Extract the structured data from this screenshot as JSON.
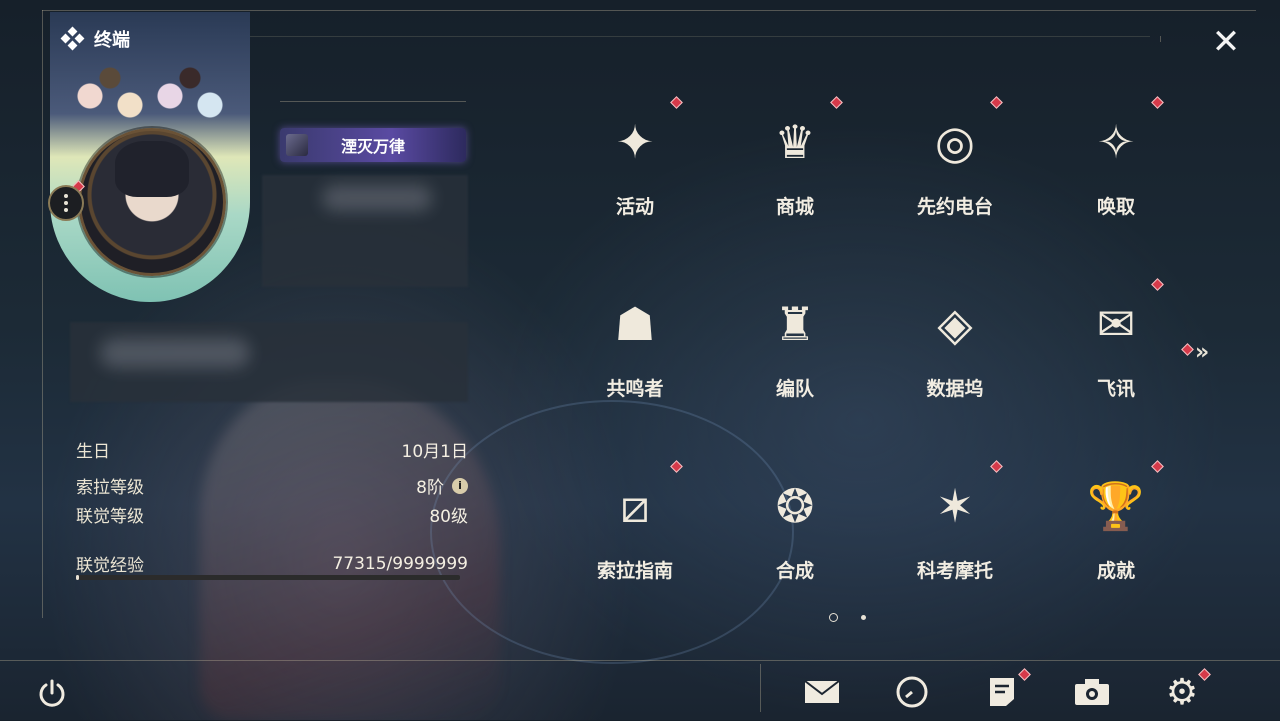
{
  "header": {
    "terminal_label": "终端"
  },
  "profile": {
    "title_badge": "湮灭万律",
    "info": [
      {
        "key": "生日",
        "value": "10月1日"
      },
      {
        "key": "索拉等级",
        "value": "8阶"
      },
      {
        "key": "联觉等级",
        "value": "80级"
      }
    ],
    "exp_label": "联觉经验",
    "exp_value": "77315/9999999",
    "exp_progress": 0.0077
  },
  "menu": [
    {
      "label": "活动",
      "icon": "event-2hd-icon",
      "glyph": "✦",
      "badge": true
    },
    {
      "label": "商城",
      "icon": "shop-cart-icon",
      "glyph": "♛",
      "badge": true
    },
    {
      "label": "先约电台",
      "icon": "radio-icon",
      "glyph": "◎",
      "badge": true
    },
    {
      "label": "唤取",
      "icon": "summon-compass-icon",
      "glyph": "✧",
      "badge": true
    },
    {
      "label": "共鸣者",
      "icon": "resonator-head-icon",
      "glyph": "☗",
      "badge": false
    },
    {
      "label": "编队",
      "icon": "team-chess-icon",
      "glyph": "♜",
      "badge": false
    },
    {
      "label": "数据坞",
      "icon": "data-dock-icon",
      "glyph": "◈",
      "badge": false
    },
    {
      "label": "飞讯",
      "icon": "message-icon",
      "glyph": "✉",
      "badge": true
    },
    {
      "label": "索拉指南",
      "icon": "guide-book-icon",
      "glyph": "⧄",
      "badge": true
    },
    {
      "label": "合成",
      "icon": "synthesis-icon",
      "glyph": "❂",
      "badge": false
    },
    {
      "label": "科考摩托",
      "icon": "motorbike-icon",
      "glyph": "✶",
      "badge": true
    },
    {
      "label": "成就",
      "icon": "trophy-icon",
      "glyph": "🏆",
      "badge": true
    }
  ],
  "pager": {
    "pages": 2,
    "current": 1
  },
  "bottom_bar": [
    "power-icon",
    "mail-icon",
    "clock-icon",
    "notice-icon",
    "camera-icon",
    "settings-gear-icon"
  ],
  "colors": {
    "badge_red": "#d63a4a",
    "accent_gold": "#b9a27a",
    "title_purple": "#5a4aa2"
  }
}
